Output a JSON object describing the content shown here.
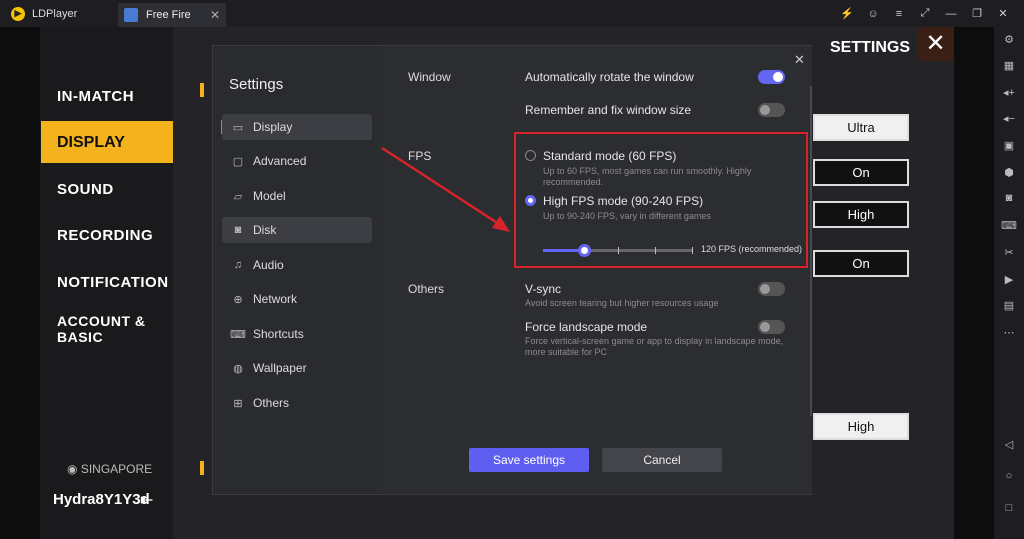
{
  "titlebar": {
    "app_name": "LDPlayer",
    "tab": "Free Fire",
    "tab_close": "✕",
    "controls": [
      "⚡",
      "☺",
      "≡",
      "⤢",
      "—",
      "❐",
      "✕"
    ]
  },
  "game": {
    "menu": [
      "IN-MATCH",
      "SOUND",
      "RECORDING",
      "NOTIFICATION",
      "ACCOUNT &",
      "BASIC"
    ],
    "active_menu": "DISPLAY",
    "header": "SETTINGS",
    "close": "✕",
    "options": [
      "Ultra",
      "On",
      "High",
      "On",
      "High"
    ],
    "region": "SINGAPORE",
    "player": "Hydra8Y1Y3d"
  },
  "modal": {
    "title": "Settings",
    "close": "✕",
    "nav": [
      {
        "label": "Display",
        "icon": "display-icon"
      },
      {
        "label": "Advanced",
        "icon": "advanced-icon"
      },
      {
        "label": "Model",
        "icon": "model-icon"
      },
      {
        "label": "Disk",
        "icon": "disk-icon"
      },
      {
        "label": "Audio",
        "icon": "audio-icon"
      },
      {
        "label": "Network",
        "icon": "network-icon"
      },
      {
        "label": "Shortcuts",
        "icon": "keyboard-icon"
      },
      {
        "label": "Wallpaper",
        "icon": "palette-icon"
      },
      {
        "label": "Others",
        "icon": "grid-icon"
      }
    ],
    "window": {
      "section": "Window",
      "auto_rotate": "Automatically rotate the window",
      "auto_rotate_on": true,
      "remember_size": "Remember and fix window size",
      "remember_on": false
    },
    "fps": {
      "section": "FPS",
      "standard_label": "Standard mode (60 FPS)",
      "standard_desc1": "Up to 60 FPS, most games can run smoothly. Highly",
      "standard_desc2": "recommended.",
      "high_label": "High FPS mode (90-240 FPS)",
      "high_desc": "Up to 90-240 FPS, vary in different games",
      "selected": "high",
      "slider_value": "120 FPS (recommended)",
      "slider_fraction": 0.27
    },
    "others": {
      "section": "Others",
      "vsync_label": "V-sync",
      "vsync_desc": "Avoid screen tearing but higher resources usage",
      "vsync_on": false,
      "landscape_label": "Force landscape mode",
      "landscape_desc1": "Force vertical-screen game or app to display in landscape mode,",
      "landscape_desc2": "more suitable for PC",
      "landscape_on": false
    },
    "buttons": {
      "save": "Save settings",
      "cancel": "Cancel"
    }
  },
  "colors": {
    "accent": "#6466f1",
    "highlight": "#d8232a",
    "game_yellow": "#f4b31c"
  }
}
